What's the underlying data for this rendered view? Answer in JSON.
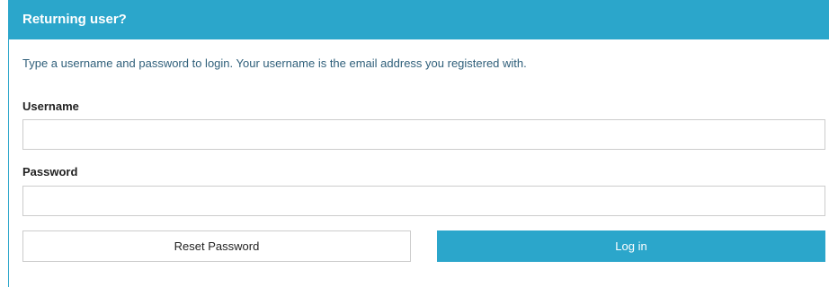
{
  "panel": {
    "title": "Returning user?",
    "intro": "Type a username and password to login. Your username is the email address you registered with."
  },
  "form": {
    "username": {
      "label": "Username",
      "value": "",
      "placeholder": ""
    },
    "password": {
      "label": "Password",
      "value": "",
      "placeholder": ""
    },
    "reset_label": "Reset Password",
    "login_label": "Log in"
  },
  "colors": {
    "accent": "#2ba6cb",
    "intro_text": "#2f5f7a",
    "border": "#cccccc"
  }
}
